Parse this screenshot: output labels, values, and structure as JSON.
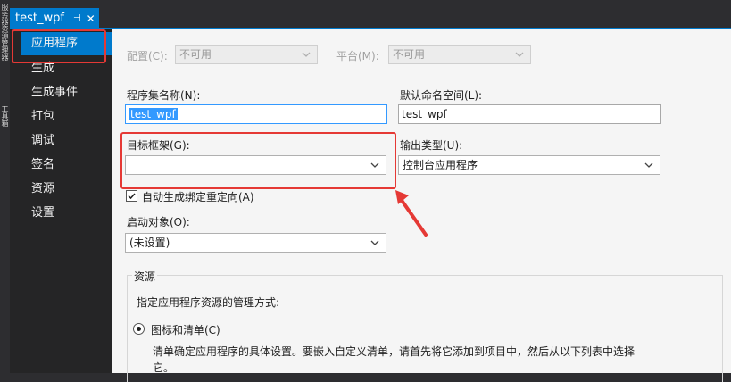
{
  "toolbox_strip": {
    "text_1": "服务器资源管理器",
    "text_2": "工具箱"
  },
  "tab": {
    "title": "test_wpf",
    "pin_glyph": "⊣",
    "close_glyph": "✕"
  },
  "nav": {
    "items": [
      {
        "label": "应用程序"
      },
      {
        "label": "生成"
      },
      {
        "label": "生成事件"
      },
      {
        "label": "打包"
      },
      {
        "label": "调试"
      },
      {
        "label": "签名"
      },
      {
        "label": "资源"
      },
      {
        "label": "设置"
      }
    ]
  },
  "config": {
    "config_label": "配置(C):",
    "config_value": "不可用",
    "platform_label": "平台(M):",
    "platform_value": "不可用"
  },
  "fields": {
    "assembly_label": "程序集名称(N):",
    "assembly_value": "test_wpf",
    "namespace_label": "默认命名空间(L):",
    "namespace_value": "test_wpf",
    "target_label": "目标框架(G):",
    "target_value": "",
    "output_label": "输出类型(U):",
    "output_value": "控制台应用程序",
    "autobind_label": "自动生成绑定重定向(A)",
    "startup_label": "启动对象(O):",
    "startup_value": "(未设置)"
  },
  "resources": {
    "group_title": "资源",
    "description": "指定应用程序资源的管理方式:",
    "radio_label": "图标和清单(C)",
    "help_line_1": "清单确定应用程序的具体设置。要嵌入自定义清单，请首先将它添加到项目中，然后从以下列表中选择",
    "help_line_2": "它。"
  },
  "colors": {
    "accent": "#007acc",
    "annotation_red": "#e53935",
    "panel_bg": "#f5f5f5"
  }
}
